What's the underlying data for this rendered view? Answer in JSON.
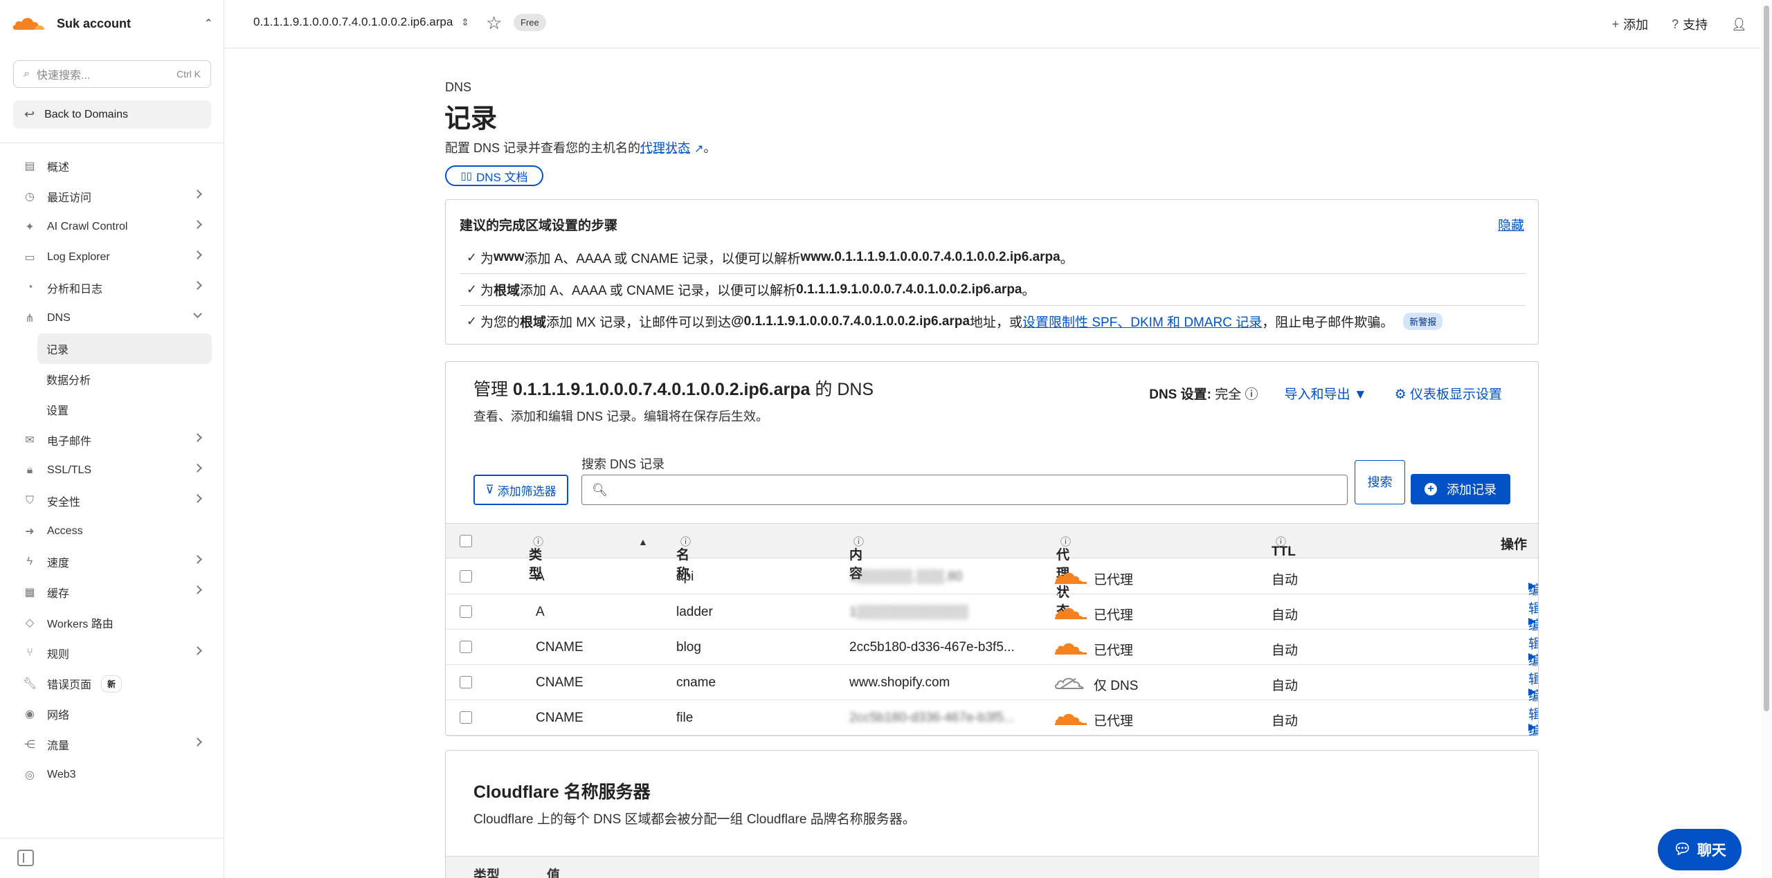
{
  "account": {
    "name": "Suk account"
  },
  "sidebar": {
    "search_placeholder": "快速搜索...",
    "search_shortcut": "Ctrl K",
    "back_label": "Back to Domains",
    "items": [
      {
        "label": "概述",
        "icon": "document-icon"
      },
      {
        "label": "最近访问",
        "icon": "clock-icon"
      },
      {
        "label": "AI Crawl Control",
        "icon": "ai-icon"
      },
      {
        "label": "Log Explorer",
        "icon": "log-icon"
      },
      {
        "label": "分析和日志",
        "icon": "chart-icon"
      },
      {
        "label": "DNS",
        "icon": "network-icon"
      },
      {
        "label": "电子邮件",
        "icon": "mail-icon"
      },
      {
        "label": "SSL/TLS",
        "icon": "lock-icon"
      },
      {
        "label": "安全性",
        "icon": "shield-icon"
      },
      {
        "label": "Access",
        "icon": "access-icon"
      },
      {
        "label": "速度",
        "icon": "bolt-icon"
      },
      {
        "label": "缓存",
        "icon": "cache-icon"
      },
      {
        "label": "Workers 路由",
        "icon": "workers-icon"
      },
      {
        "label": "规则",
        "icon": "rules-icon"
      },
      {
        "label": "错误页面",
        "icon": "wrench-icon",
        "badge": "新"
      },
      {
        "label": "网络",
        "icon": "location-icon"
      },
      {
        "label": "流量",
        "icon": "traffic-icon"
      },
      {
        "label": "Web3",
        "icon": "web3-icon"
      }
    ],
    "dns_sub": [
      "记录",
      "数据分析",
      "设置"
    ]
  },
  "topbar": {
    "zone": "0.1.1.1.9.1.0.0.0.7.4.0.1.0.0.2.ip6.arpa",
    "plan": "Free",
    "add": "添加",
    "support": "支持"
  },
  "page": {
    "crumb": "DNS",
    "title": "记录",
    "desc_before": "配置 DNS 记录并查看您的主机名的",
    "desc_link": "代理状态",
    "desc_after": "。",
    "doc_btn": "DNS 文档"
  },
  "steps": {
    "title": "建议的完成区域设置的步骤",
    "hide": "隐藏",
    "row1": {
      "a": "为 ",
      "b": "www",
      "c": " 添加 A、AAAA 或 CNAME 记录，以便可以解析 ",
      "d": "www.0.1.1.1.9.1.0.0.0.7.4.0.1.0.0.2.ip6.arpa",
      "e": "。"
    },
    "row2": {
      "a": "为",
      "b": "根域",
      "c": "添加 A、AAAA 或 CNAME 记录，以便可以解析 ",
      "d": "0.1.1.1.9.1.0.0.0.7.4.0.1.0.0.2.ip6.arpa",
      "e": "。"
    },
    "row3": {
      "a": "为您的",
      "b": "根域",
      "c": "添加 MX 记录，让邮件可以到达 ",
      "d": "@0.1.1.1.9.1.0.0.0.7.4.0.1.0.0.2.ip6.arpa",
      "e": " 地址，或",
      "link": "设置限制性 SPF、DKIM 和 DMARC 记录",
      "f": "，阻止电子邮件欺骗。",
      "badge": "新警报"
    }
  },
  "manage": {
    "title_before": "管理 ",
    "title_zone": "0.1.1.1.9.1.0.0.0.7.4.0.1.0.0.2.ip6.arpa",
    "title_after": " 的 DNS",
    "desc": "查看、添加和编辑 DNS 记录。编辑将在保存后生效。",
    "dns_setting_label": "DNS 设置:",
    "dns_setting_value": " 完全",
    "import_export": "导入和导出",
    "dash_settings": "仪表板显示设置",
    "search_label": "搜索 DNS 记录",
    "filter_btn": "添加筛选器",
    "search_btn": "搜索",
    "add_btn": "添加记录",
    "columns": {
      "type": "类型",
      "name": "名称",
      "content": "内容",
      "proxy": "代理状态",
      "ttl": "TTL",
      "actions": "操作"
    },
    "rows": [
      {
        "type": "A",
        "name": "api",
        "content": "1▒▒▒▒▒▒.▒▒▒.80",
        "proxy": "已代理",
        "proxied": true,
        "ttl": "自动",
        "edit": "编辑"
      },
      {
        "type": "A",
        "name": "ladder",
        "content": "1▒▒▒▒▒▒▒▒▒▒▒▒",
        "proxy": "已代理",
        "proxied": true,
        "ttl": "自动",
        "edit": "编辑"
      },
      {
        "type": "CNAME",
        "name": "blog",
        "content": "2cc5b180-d336-467e-b3f5...",
        "proxy": "已代理",
        "proxied": true,
        "ttl": "自动",
        "edit": "编辑"
      },
      {
        "type": "CNAME",
        "name": "cname",
        "content": "www.shopify.com",
        "proxy": "仅 DNS",
        "proxied": false,
        "ttl": "自动",
        "edit": "编辑"
      },
      {
        "type": "CNAME",
        "name": "file",
        "content": "2cc5b180-d336-467e-b3f5...",
        "proxy": "已代理",
        "proxied": true,
        "ttl": "自动",
        "edit": "编辑"
      }
    ]
  },
  "nameservers": {
    "title": "Cloudflare 名称服务器",
    "desc": "Cloudflare 上的每个 DNS 区域都会被分配一组 Cloudflare 品牌名称服务器。",
    "col_type": "类型",
    "col_value": "值"
  },
  "chat": {
    "label": "聊天"
  },
  "colors": {
    "accent": "#0051c3",
    "orange": "#f6821f"
  }
}
